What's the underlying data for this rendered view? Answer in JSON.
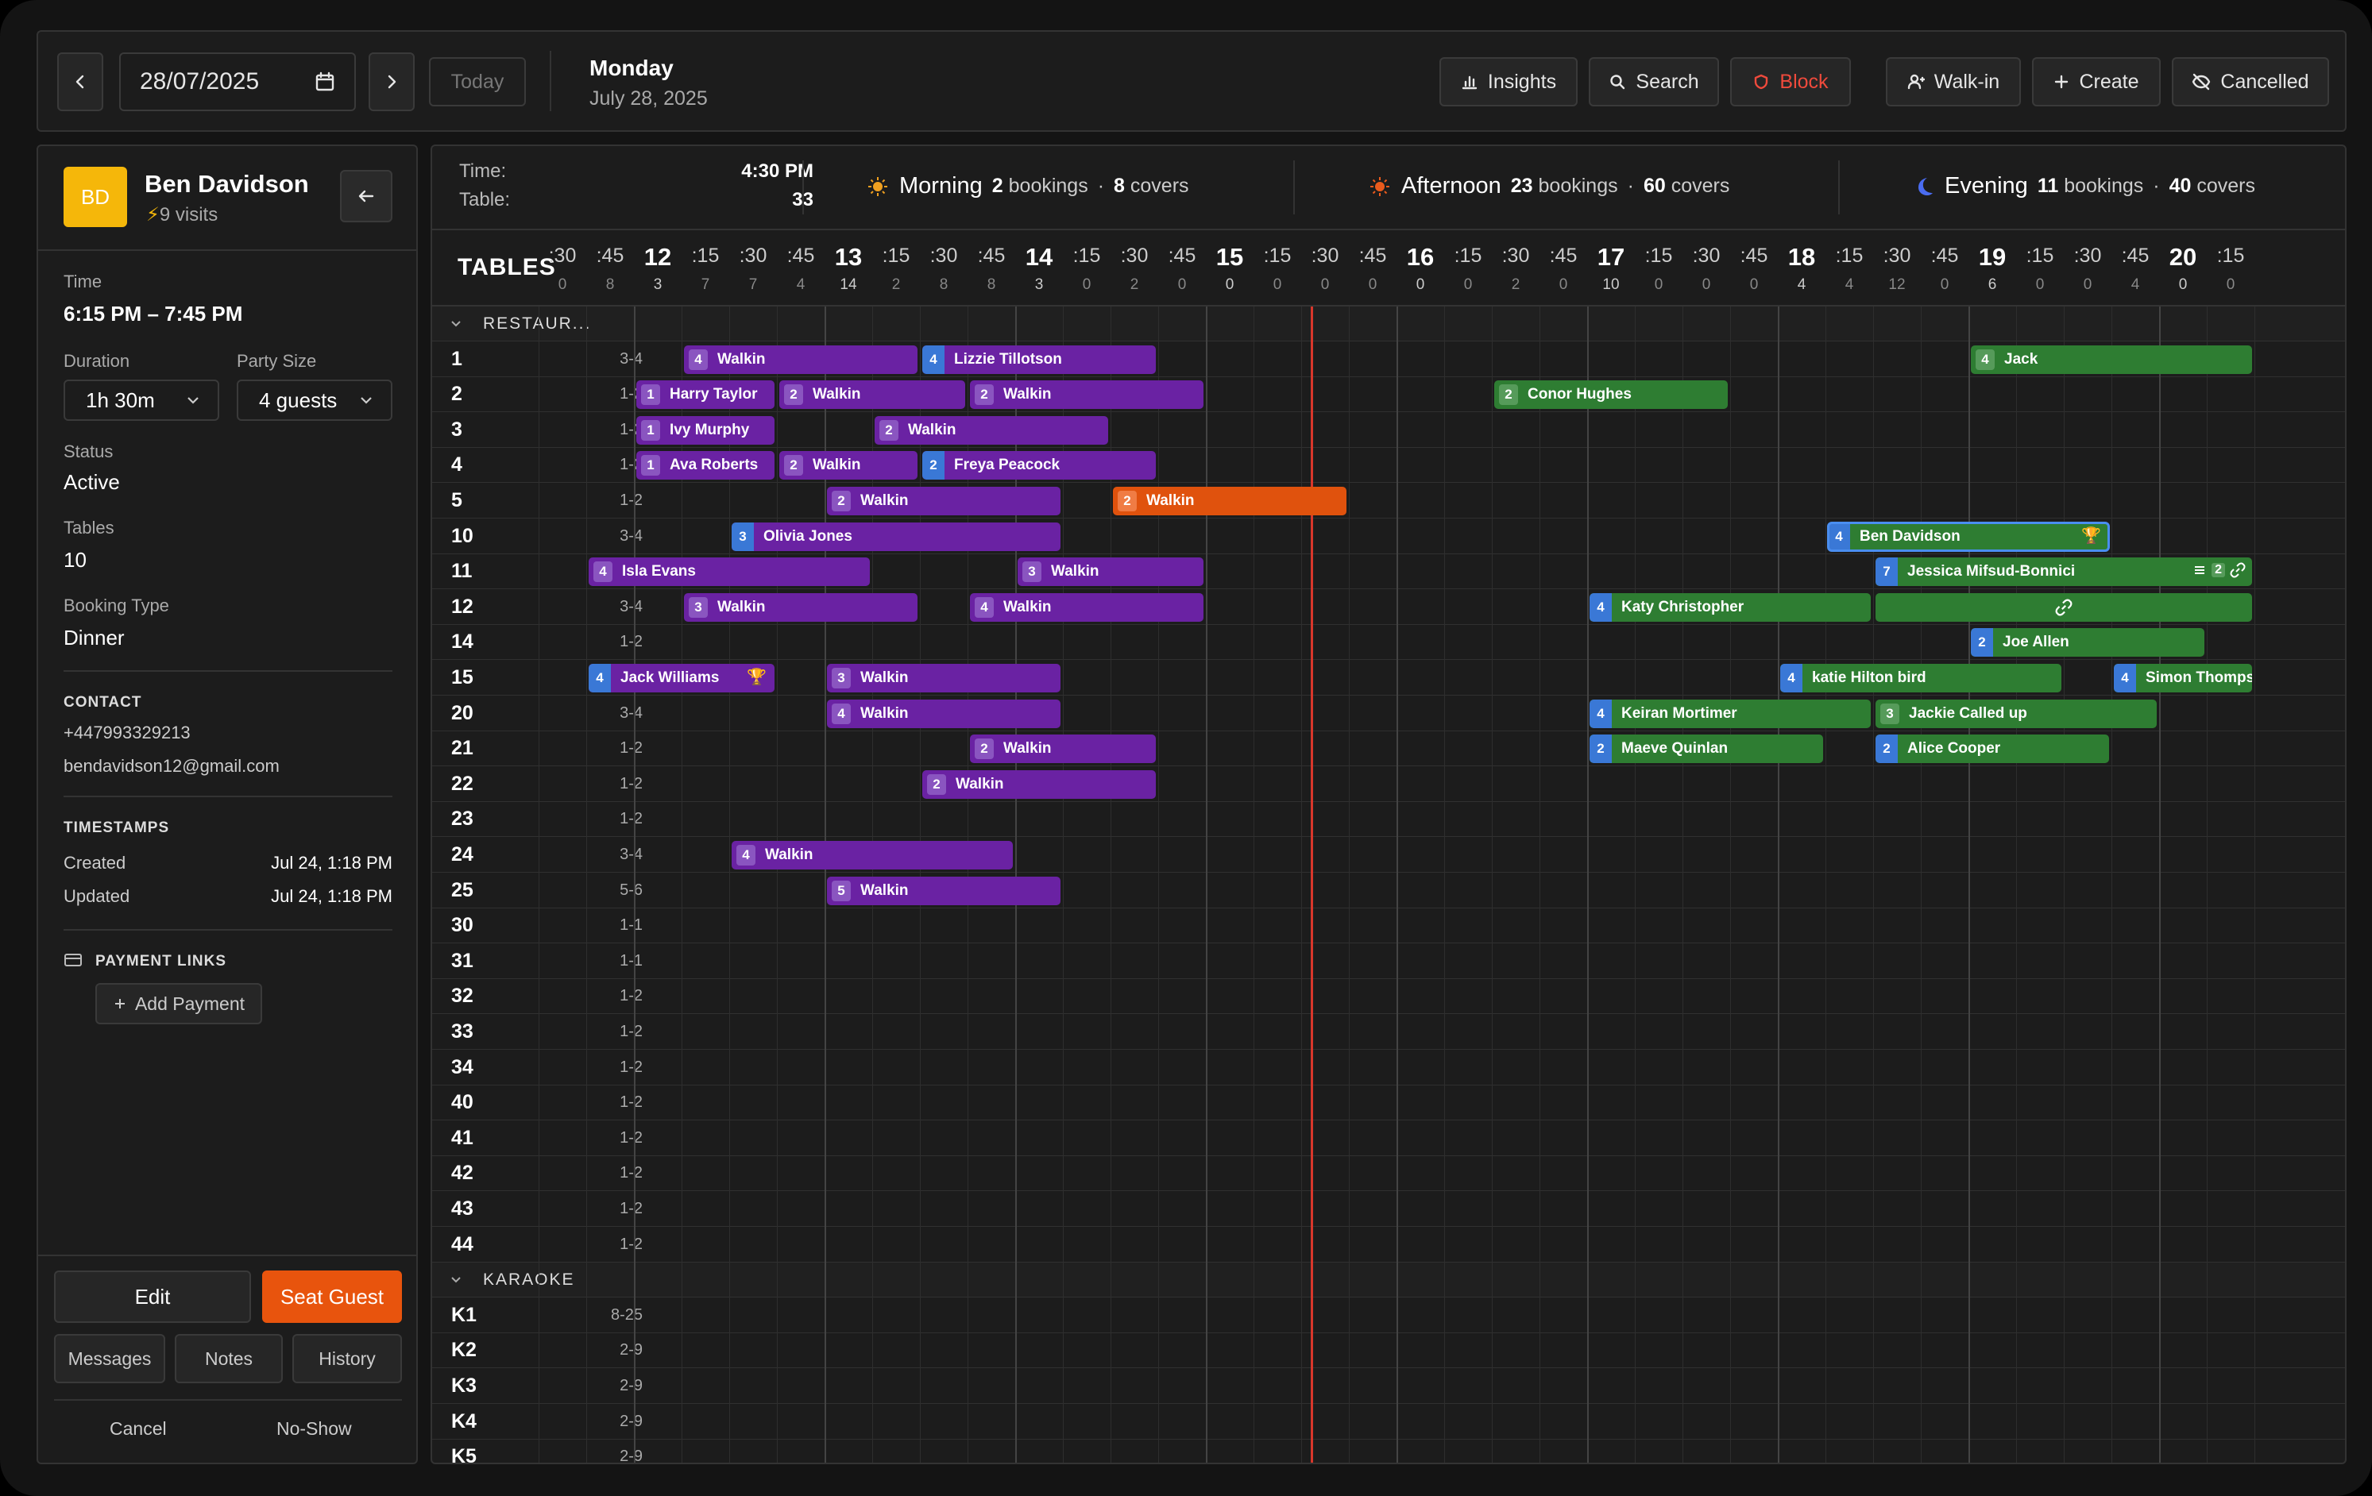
{
  "topbar": {
    "date_value": "28/07/2025",
    "today_label": "Today",
    "day_name": "Monday",
    "day_date": "July 28, 2025",
    "insights_label": "Insights",
    "search_label": "Search",
    "block_label": "Block",
    "walkin_label": "Walk-in",
    "create_label": "Create",
    "cancelled_label": "Cancelled"
  },
  "guest": {
    "initials": "BD",
    "name": "Ben Davidson",
    "visits": "9 visits",
    "time_label": "Time",
    "time_value": "6:15 PM – 7:45 PM",
    "duration_label": "Duration",
    "duration_value": "1h 30m",
    "party_label": "Party Size",
    "party_value": "4 guests",
    "status_label": "Status",
    "status_value": "Active",
    "tables_label": "Tables",
    "tables_value": "10",
    "booking_type_label": "Booking Type",
    "booking_type_value": "Dinner",
    "contact_title": "CONTACT",
    "phone": "+447993329213",
    "email": "bendavidson12@gmail.com",
    "timestamps_title": "TIMESTAMPS",
    "created_label": "Created",
    "created_value": "Jul 24, 1:18 PM",
    "updated_label": "Updated",
    "updated_value": "Jul 24, 1:18 PM",
    "payment_title": "PAYMENT LINKS",
    "add_payment_label": "Add Payment",
    "edit_label": "Edit",
    "seat_label": "Seat Guest",
    "messages_label": "Messages",
    "notes_label": "Notes",
    "history_label": "History",
    "cancel_label": "Cancel",
    "noshow_label": "No-Show"
  },
  "summary": {
    "time_label": "Time:",
    "time_value": "4:30 PM",
    "table_label": "Table:",
    "table_value": "33",
    "morning": {
      "name": "Morning",
      "bookings": "2",
      "covers": "8"
    },
    "afternoon": {
      "name": "Afternoon",
      "bookings": "23",
      "covers": "60"
    },
    "evening": {
      "name": "Evening",
      "bookings": "11",
      "covers": "40"
    },
    "bookings_word": "bookings",
    "covers_word": "covers",
    "dot": "·"
  },
  "grid": {
    "tables_title": "TABLES",
    "time_columns": [
      {
        "t": ":30",
        "c": "0"
      },
      {
        "t": ":45",
        "c": "8"
      },
      {
        "t": "12",
        "c": "3",
        "hour": true
      },
      {
        "t": ":15",
        "c": "7"
      },
      {
        "t": ":30",
        "c": "7"
      },
      {
        "t": ":45",
        "c": "4"
      },
      {
        "t": "13",
        "c": "14",
        "hour": true
      },
      {
        "t": ":15",
        "c": "2"
      },
      {
        "t": ":30",
        "c": "8"
      },
      {
        "t": ":45",
        "c": "8"
      },
      {
        "t": "14",
        "c": "3",
        "hour": true
      },
      {
        "t": ":15",
        "c": "0"
      },
      {
        "t": ":30",
        "c": "2"
      },
      {
        "t": ":45",
        "c": "0"
      },
      {
        "t": "15",
        "c": "0",
        "hour": true
      },
      {
        "t": ":15",
        "c": "0"
      },
      {
        "t": ":30",
        "c": "0"
      },
      {
        "t": ":45",
        "c": "0"
      },
      {
        "t": "16",
        "c": "0",
        "hour": true
      },
      {
        "t": ":15",
        "c": "0"
      },
      {
        "t": ":30",
        "c": "2"
      },
      {
        "t": ":45",
        "c": "0"
      },
      {
        "t": "17",
        "c": "10",
        "hour": true
      },
      {
        "t": ":15",
        "c": "0"
      },
      {
        "t": ":30",
        "c": "0"
      },
      {
        "t": ":45",
        "c": "0"
      },
      {
        "t": "18",
        "c": "4",
        "hour": true
      },
      {
        "t": ":15",
        "c": "4"
      },
      {
        "t": ":30",
        "c": "12"
      },
      {
        "t": ":45",
        "c": "0"
      },
      {
        "t": "19",
        "c": "6",
        "hour": true
      },
      {
        "t": ":15",
        "c": "0"
      },
      {
        "t": ":30",
        "c": "0"
      },
      {
        "t": ":45",
        "c": "4"
      },
      {
        "t": "20",
        "c": "0",
        "hour": true
      },
      {
        "t": ":15",
        "c": "0"
      }
    ],
    "now_slot": 16.2,
    "rows": [
      {
        "section": "RESTAUR..."
      },
      {
        "name": "1",
        "cap": "3-4"
      },
      {
        "name": "2",
        "cap": "1-2"
      },
      {
        "name": "3",
        "cap": "1-2"
      },
      {
        "name": "4",
        "cap": "1-2"
      },
      {
        "name": "5",
        "cap": "1-2"
      },
      {
        "name": "10",
        "cap": "3-4"
      },
      {
        "name": "11",
        "cap": "3-4"
      },
      {
        "name": "12",
        "cap": "3-4"
      },
      {
        "name": "14",
        "cap": "1-2"
      },
      {
        "name": "15",
        "cap": "3-4"
      },
      {
        "name": "20",
        "cap": "3-4"
      },
      {
        "name": "21",
        "cap": "1-2"
      },
      {
        "name": "22",
        "cap": "1-2"
      },
      {
        "name": "23",
        "cap": "1-2"
      },
      {
        "name": "24",
        "cap": "3-4"
      },
      {
        "name": "25",
        "cap": "5-6"
      },
      {
        "name": "30",
        "cap": "1-1"
      },
      {
        "name": "31",
        "cap": "1-1"
      },
      {
        "name": "32",
        "cap": "1-2"
      },
      {
        "name": "33",
        "cap": "1-2"
      },
      {
        "name": "34",
        "cap": "1-2"
      },
      {
        "name": "40",
        "cap": "1-2"
      },
      {
        "name": "41",
        "cap": "1-2"
      },
      {
        "name": "42",
        "cap": "1-2"
      },
      {
        "name": "43",
        "cap": "1-2"
      },
      {
        "name": "44",
        "cap": "1-2"
      },
      {
        "section": "KARAOKE"
      },
      {
        "name": "K1",
        "cap": "8-25"
      },
      {
        "name": "K2",
        "cap": "2-9"
      },
      {
        "name": "K3",
        "cap": "2-9"
      },
      {
        "name": "K4",
        "cap": "2-9"
      },
      {
        "name": "K5",
        "cap": "2-9"
      }
    ],
    "bookings": [
      {
        "row": 1,
        "start": 3,
        "len": 5,
        "n": "4",
        "name": "Walkin",
        "color": "p"
      },
      {
        "row": 1,
        "start": 8,
        "len": 5,
        "n": "4",
        "name": "Lizzie Tillotson",
        "color": "p",
        "badge": "b"
      },
      {
        "row": 1,
        "start": 30,
        "len": 6,
        "n": "4",
        "name": "Jack",
        "color": "g"
      },
      {
        "row": 2,
        "start": 2,
        "len": 3,
        "n": "1",
        "name": "Harry Taylor",
        "color": "p"
      },
      {
        "row": 2,
        "start": 5,
        "len": 4,
        "n": "2",
        "name": "Walkin",
        "color": "p"
      },
      {
        "row": 2,
        "start": 9,
        "len": 5,
        "n": "2",
        "name": "Walkin",
        "color": "p"
      },
      {
        "row": 2,
        "start": 20,
        "len": 5,
        "n": "2",
        "name": "Conor Hughes",
        "color": "g"
      },
      {
        "row": 3,
        "start": 2,
        "len": 3,
        "n": "1",
        "name": "Ivy Murphy",
        "color": "p"
      },
      {
        "row": 3,
        "start": 7,
        "len": 5,
        "n": "2",
        "name": "Walkin",
        "color": "p"
      },
      {
        "row": 4,
        "start": 2,
        "len": 3,
        "n": "1",
        "name": "Ava Roberts",
        "color": "p"
      },
      {
        "row": 4,
        "start": 5,
        "len": 3,
        "n": "2",
        "name": "Walkin",
        "color": "p"
      },
      {
        "row": 4,
        "start": 8,
        "len": 5,
        "n": "2",
        "name": "Freya Peacock",
        "color": "p",
        "badge": "b"
      },
      {
        "row": 5,
        "start": 6,
        "len": 5,
        "n": "2",
        "name": "Walkin",
        "color": "p"
      },
      {
        "row": 5,
        "start": 12,
        "len": 5,
        "n": "2",
        "name": "Walkin",
        "color": "o"
      },
      {
        "row": 6,
        "start": 4,
        "len": 7,
        "n": "3",
        "name": "Olivia Jones",
        "color": "p",
        "badge": "b"
      },
      {
        "row": 6,
        "start": 27,
        "len": 6,
        "n": "4",
        "name": "Ben Davidson",
        "color": "g",
        "badge": "b",
        "selected": true,
        "trophy": true
      },
      {
        "row": 7,
        "start": 1,
        "len": 6,
        "n": "4",
        "name": "Isla Evans",
        "color": "p"
      },
      {
        "row": 7,
        "start": 10,
        "len": 4,
        "n": "3",
        "name": "Walkin",
        "color": "p"
      },
      {
        "row": 7,
        "start": 28,
        "len": 8,
        "n": "7",
        "name": "Jessica Mifsud-Bonnici",
        "color": "g",
        "badge": "b",
        "icons": true,
        "extra": "2"
      },
      {
        "row": 8,
        "start": 3,
        "len": 5,
        "n": "3",
        "name": "Walkin",
        "color": "p"
      },
      {
        "row": 8,
        "start": 9,
        "len": 5,
        "n": "4",
        "name": "Walkin",
        "color": "p"
      },
      {
        "row": 8,
        "start": 22,
        "len": 6,
        "n": "4",
        "name": "Katy Christopher",
        "color": "g",
        "badge": "b"
      },
      {
        "row": 9,
        "start": 30,
        "len": 5,
        "n": "2",
        "name": "Joe Allen",
        "color": "g",
        "badge": "b"
      },
      {
        "row": 10,
        "start": 1,
        "len": 4,
        "n": "4",
        "name": "Jack Williams",
        "color": "p",
        "badge": "b",
        "trophy": true
      },
      {
        "row": 10,
        "start": 6,
        "len": 5,
        "n": "3",
        "name": "Walkin",
        "color": "p"
      },
      {
        "row": 10,
        "start": 26,
        "len": 6,
        "n": "4",
        "name": "katie Hilton bird",
        "color": "g",
        "badge": "b"
      },
      {
        "row": 10,
        "start": 33,
        "len": 3,
        "n": "4",
        "name": "Simon Thomps",
        "color": "g",
        "badge": "b"
      },
      {
        "row": 11,
        "start": 6,
        "len": 5,
        "n": "4",
        "name": "Walkin",
        "color": "p"
      },
      {
        "row": 11,
        "start": 22,
        "len": 6,
        "n": "4",
        "name": "Keiran Mortimer",
        "color": "g",
        "badge": "b"
      },
      {
        "row": 11,
        "start": 28,
        "len": 6,
        "n": "3",
        "name": "Jackie Called up",
        "color": "g"
      },
      {
        "row": 12,
        "start": 9,
        "len": 4,
        "n": "2",
        "name": "Walkin",
        "color": "p"
      },
      {
        "row": 12,
        "start": 22,
        "len": 5,
        "n": "2",
        "name": "Maeve Quinlan",
        "color": "g",
        "badge": "b"
      },
      {
        "row": 12,
        "start": 28,
        "len": 5,
        "n": "2",
        "name": "Alice Cooper",
        "color": "g",
        "badge": "b"
      },
      {
        "row": 13,
        "start": 8,
        "len": 5,
        "n": "2",
        "name": "Walkin",
        "color": "p"
      },
      {
        "row": 15,
        "start": 4,
        "len": 6,
        "n": "4",
        "name": "Walkin",
        "color": "p"
      },
      {
        "row": 16,
        "start": 6,
        "len": 5,
        "n": "5",
        "name": "Walkin",
        "color": "p"
      }
    ]
  }
}
